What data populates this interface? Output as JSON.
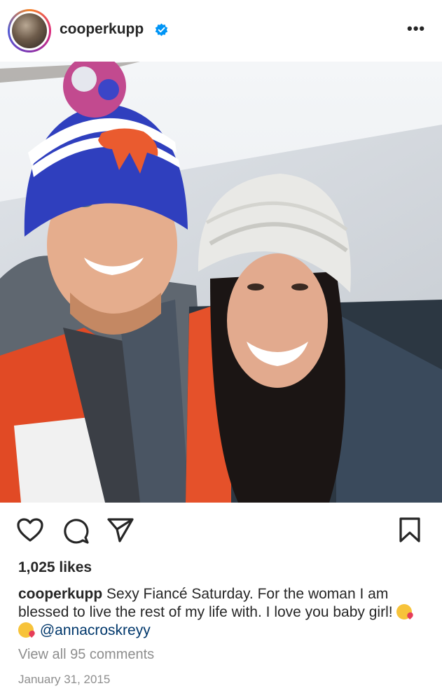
{
  "post": {
    "username": "cooperkupp",
    "more_label": "•••",
    "photo_alt": "",
    "likes": "1,025 likes",
    "caption": {
      "username": "cooperkupp",
      "text": "Sexy Fiancé Saturday. For the woman I am blessed to live the rest of my life with. I love you baby girl!",
      "mention": "@annacroskreyy"
    },
    "comments_link": "View all 95 comments",
    "date": "January 31, 2015"
  },
  "icons": {
    "verified": "verified-badge-icon",
    "like": "heart-icon",
    "comment": "comment-bubble-icon",
    "share": "paper-plane-icon",
    "save": "bookmark-icon",
    "emoji": "face-blowing-kiss-emoji"
  },
  "colors": {
    "verified_blue": "#0095f6",
    "text": "#262626",
    "muted": "#8e8e8e",
    "mention": "#00376b"
  }
}
